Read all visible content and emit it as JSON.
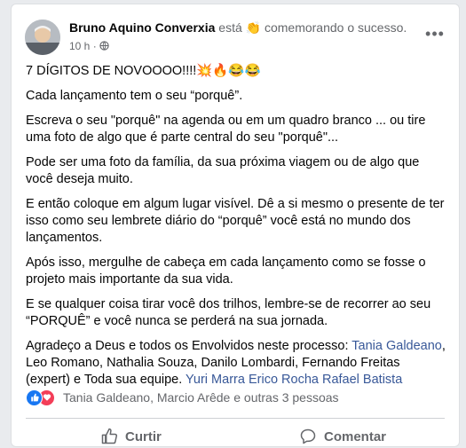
{
  "post": {
    "author": "Bruno Aquino Converxia",
    "activity": "está 👏 comemorando o sucesso.",
    "time": "10 h",
    "audience_icon": "globe-icon",
    "paragraphs": [
      "7 DÍGITOS DE NOVOOOO!!!!💥🔥😂😂",
      "Cada lançamento tem o seu “porquê”.",
      "Escreva o seu \"porquê\" na agenda ou em um quadro branco ... ou tire uma foto de algo que é parte central do seu \"porquê\"...",
      "Pode ser uma foto da família, da sua próxima viagem ou de algo que você deseja muito.",
      "E então coloque em algum lugar visível. Dê a si mesmo o presente de ter isso como seu lembrete diário do “porquê” você está no mundo dos lançamentos.",
      "Após isso, mergulhe de cabeça em cada lançamento como se fosse o projeto mais importante da sua vida.",
      "E se qualquer coisa tirar você dos trilhos, lembre-se de recorrer ao seu “PORQUÊ” e você nunca se perderá na sua jornada."
    ],
    "thanks": {
      "lead": "Agradeço a Deus e todos os Envolvidos neste processo: ",
      "link1": "Tania Galdeano",
      "middle": ", Leo Romano, Nathalia Souza, Danilo Lombardi, Fernando Freitas (expert) e Toda sua equipe. ",
      "link2": "Yuri Marra",
      "space": " ",
      "link3": "Erico Rocha",
      "link4": "Rafael Batista"
    }
  },
  "reactions": {
    "icons": [
      "like-icon",
      "love-icon"
    ],
    "summary": "Tania Galdeano, Marcio Arêde e outras 3 pessoas"
  },
  "actions": {
    "like_label": "Curtir",
    "comment_label": "Comentar"
  },
  "colors": {
    "link": "#385898",
    "like": "#1877f2",
    "love": "#f33e58",
    "muted": "#65676b"
  }
}
